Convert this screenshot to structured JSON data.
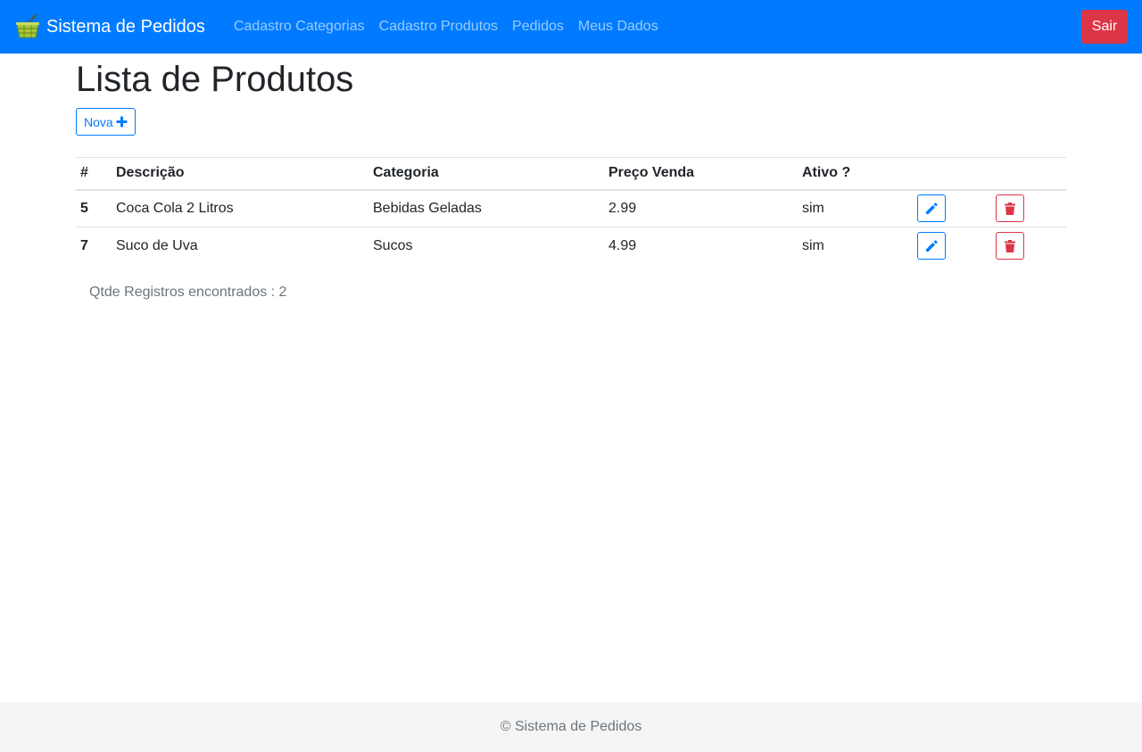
{
  "navbar": {
    "brand": "Sistema de Pedidos",
    "links": [
      "Cadastro Categorias",
      "Cadastro Produtos",
      "Pedidos",
      "Meus Dados"
    ],
    "logout_label": "Sair"
  },
  "main": {
    "title": "Lista de Produtos",
    "new_button_label": "Nova",
    "table": {
      "headers": [
        "#",
        "Descrição",
        "Categoria",
        "Preço Venda",
        "Ativo ?"
      ],
      "rows": [
        {
          "id": "5",
          "descricao": "Coca Cola 2 Litros",
          "categoria": "Bebidas Geladas",
          "preco": "2.99",
          "ativo": "sim"
        },
        {
          "id": "7",
          "descricao": "Suco de Uva",
          "categoria": "Sucos",
          "preco": "4.99",
          "ativo": "sim"
        }
      ]
    },
    "record_count": "Qtde Registros encontrados : 2"
  },
  "footer": {
    "text": "© Sistema de Pedidos"
  },
  "colors": {
    "primary": "#007bff",
    "danger": "#dc3545",
    "muted": "#6c757d",
    "footer_bg": "#f5f5f5"
  }
}
